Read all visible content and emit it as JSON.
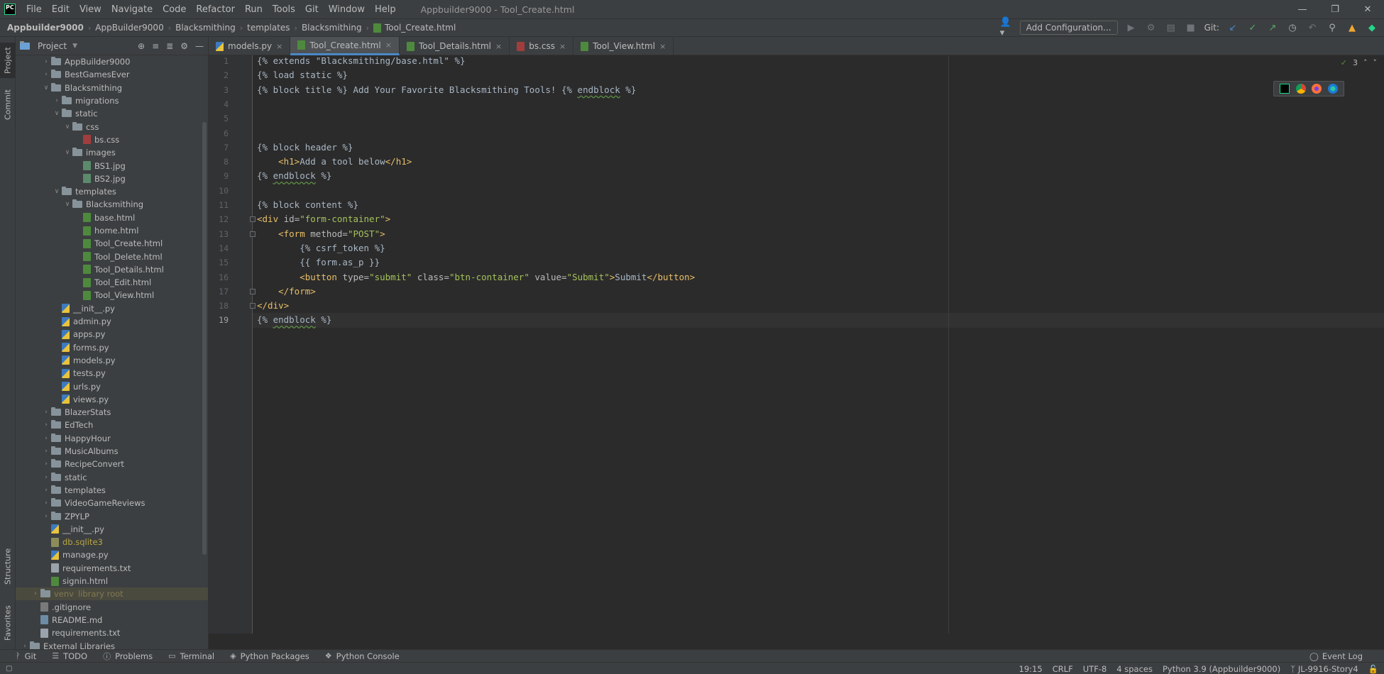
{
  "app": {
    "logo_text": "PC",
    "window_title": "Appbuilder9000 - Tool_Create.html",
    "menu": [
      "File",
      "Edit",
      "View",
      "Navigate",
      "Code",
      "Refactor",
      "Run",
      "Tools",
      "Git",
      "Window",
      "Help"
    ]
  },
  "breadcrumbs": [
    "Appbuilder9000",
    "AppBuilder9000",
    "Blacksmithing",
    "templates",
    "Blacksmithing",
    "Tool_Create.html"
  ],
  "toolbar": {
    "add_configuration": "Add Configuration...",
    "git_label": "Git:"
  },
  "left_stripe": {
    "project": "Project",
    "commit": "Commit",
    "structure": "Structure",
    "favorites": "Favorites"
  },
  "project_panel": {
    "title": "Project",
    "tree": [
      {
        "label": "AppBuilder9000",
        "type": "folder",
        "depth": 3,
        "expanded": false
      },
      {
        "label": "BestGamesEver",
        "type": "folder",
        "depth": 3,
        "expanded": false
      },
      {
        "label": "Blacksmithing",
        "type": "folder",
        "depth": 3,
        "expanded": true
      },
      {
        "label": "migrations",
        "type": "folder",
        "depth": 4,
        "expanded": false
      },
      {
        "label": "static",
        "type": "folder",
        "depth": 4,
        "expanded": true
      },
      {
        "label": "css",
        "type": "folder",
        "depth": 5,
        "expanded": true
      },
      {
        "label": "bs.css",
        "type": "css",
        "depth": 6
      },
      {
        "label": "images",
        "type": "folder",
        "depth": 5,
        "expanded": true
      },
      {
        "label": "BS1.jpg",
        "type": "img",
        "depth": 6
      },
      {
        "label": "BS2.jpg",
        "type": "img",
        "depth": 6
      },
      {
        "label": "templates",
        "type": "folder",
        "depth": 4,
        "expanded": true
      },
      {
        "label": "Blacksmithing",
        "type": "folder",
        "depth": 5,
        "expanded": true
      },
      {
        "label": "base.html",
        "type": "html",
        "depth": 6
      },
      {
        "label": "home.html",
        "type": "html",
        "depth": 6
      },
      {
        "label": "Tool_Create.html",
        "type": "html",
        "depth": 6
      },
      {
        "label": "Tool_Delete.html",
        "type": "html",
        "depth": 6
      },
      {
        "label": "Tool_Details.html",
        "type": "html",
        "depth": 6
      },
      {
        "label": "Tool_Edit.html",
        "type": "html",
        "depth": 6
      },
      {
        "label": "Tool_View.html",
        "type": "html",
        "depth": 6
      },
      {
        "label": "__init__.py",
        "type": "py",
        "depth": 4
      },
      {
        "label": "admin.py",
        "type": "py",
        "depth": 4
      },
      {
        "label": "apps.py",
        "type": "py",
        "depth": 4
      },
      {
        "label": "forms.py",
        "type": "py",
        "depth": 4
      },
      {
        "label": "models.py",
        "type": "py",
        "depth": 4
      },
      {
        "label": "tests.py",
        "type": "py",
        "depth": 4
      },
      {
        "label": "urls.py",
        "type": "py",
        "depth": 4
      },
      {
        "label": "views.py",
        "type": "py",
        "depth": 4
      },
      {
        "label": "BlazerStats",
        "type": "folder",
        "depth": 3,
        "expanded": false
      },
      {
        "label": "EdTech",
        "type": "folder",
        "depth": 3,
        "expanded": false
      },
      {
        "label": "HappyHour",
        "type": "folder",
        "depth": 3,
        "expanded": false
      },
      {
        "label": "MusicAlbums",
        "type": "folder",
        "depth": 3,
        "expanded": false
      },
      {
        "label": "RecipeConvert",
        "type": "folder",
        "depth": 3,
        "expanded": false
      },
      {
        "label": "static",
        "type": "folder",
        "depth": 3,
        "expanded": false
      },
      {
        "label": "templates",
        "type": "folder",
        "depth": 3,
        "expanded": false
      },
      {
        "label": "VideoGameReviews",
        "type": "folder",
        "depth": 3,
        "expanded": false
      },
      {
        "label": "ZPYLP",
        "type": "folder",
        "depth": 3,
        "expanded": false
      },
      {
        "label": "__init__.py",
        "type": "py",
        "depth": 3
      },
      {
        "label": "db.sqlite3",
        "type": "db",
        "depth": 3,
        "muted": true
      },
      {
        "label": "manage.py",
        "type": "py",
        "depth": 3
      },
      {
        "label": "requirements.txt",
        "type": "txt",
        "depth": 3
      },
      {
        "label": "signin.html",
        "type": "html",
        "depth": 3
      },
      {
        "label": "venv",
        "suffix": "library root",
        "type": "folder",
        "depth": 2,
        "expanded": false,
        "selected": true
      },
      {
        "label": ".gitignore",
        "type": "git",
        "depth": 2
      },
      {
        "label": "README.md",
        "type": "md",
        "depth": 2
      },
      {
        "label": "requirements.txt",
        "type": "txt",
        "depth": 2
      },
      {
        "label": "External Libraries",
        "type": "folder",
        "depth": 1,
        "expanded": false
      }
    ]
  },
  "tabs": [
    {
      "label": "models.py",
      "type": "py",
      "active": false
    },
    {
      "label": "Tool_Create.html",
      "type": "html",
      "active": true
    },
    {
      "label": "Tool_Details.html",
      "type": "html",
      "active": false
    },
    {
      "label": "bs.css",
      "type": "css",
      "active": false
    },
    {
      "label": "Tool_View.html",
      "type": "html",
      "active": false
    }
  ],
  "editor": {
    "inspection_count": "3",
    "current_line": 19,
    "lines": [
      [
        {
          "t": "{% extends ",
          "c": "tpl"
        },
        {
          "t": "\"Blacksmithing/base.html\"",
          "c": "tpl"
        },
        {
          "t": " %}",
          "c": "tpl"
        }
      ],
      [
        {
          "t": "{% load static %}",
          "c": "tpl"
        }
      ],
      [
        {
          "t": "{% block title %} Add Your Favorite Blacksmithing Tools! {% ",
          "c": "tpl"
        },
        {
          "t": "endblock",
          "c": "under"
        },
        {
          "t": " %}",
          "c": "tpl"
        }
      ],
      [],
      [],
      [],
      [
        {
          "t": "{% block header %}",
          "c": "tpl"
        }
      ],
      [
        {
          "t": "    ",
          "c": "tpl"
        },
        {
          "t": "<h1>",
          "c": "tag"
        },
        {
          "t": "Add a tool below",
          "c": "tpl"
        },
        {
          "t": "</h1>",
          "c": "tag"
        }
      ],
      [
        {
          "t": "{% ",
          "c": "tpl"
        },
        {
          "t": "endblock",
          "c": "under"
        },
        {
          "t": " %}",
          "c": "tpl"
        }
      ],
      [],
      [
        {
          "t": "{% block content %}",
          "c": "tpl"
        }
      ],
      [
        {
          "t": "<div ",
          "c": "tag"
        },
        {
          "t": "id=",
          "c": "attr"
        },
        {
          "t": "\"form-container\"",
          "c": "str"
        },
        {
          "t": ">",
          "c": "tag"
        }
      ],
      [
        {
          "t": "    ",
          "c": "tpl"
        },
        {
          "t": "<form ",
          "c": "tag"
        },
        {
          "t": "method=",
          "c": "attr"
        },
        {
          "t": "\"POST\"",
          "c": "str"
        },
        {
          "t": ">",
          "c": "tag"
        }
      ],
      [
        {
          "t": "        {% csrf_token %}",
          "c": "tpl"
        }
      ],
      [
        {
          "t": "        {{ form.as_p }}",
          "c": "tpl"
        }
      ],
      [
        {
          "t": "        ",
          "c": "tpl"
        },
        {
          "t": "<button ",
          "c": "tag"
        },
        {
          "t": "type=",
          "c": "attr"
        },
        {
          "t": "\"submit\" ",
          "c": "str"
        },
        {
          "t": "class=",
          "c": "attr"
        },
        {
          "t": "\"btn-container\" ",
          "c": "str"
        },
        {
          "t": "value=",
          "c": "attr"
        },
        {
          "t": "\"Submit\"",
          "c": "str"
        },
        {
          "t": ">",
          "c": "tag"
        },
        {
          "t": "Submit",
          "c": "tpl"
        },
        {
          "t": "</button>",
          "c": "tag"
        }
      ],
      [
        {
          "t": "    ",
          "c": "tpl"
        },
        {
          "t": "</form>",
          "c": "tag"
        }
      ],
      [
        {
          "t": "</div>",
          "c": "tag"
        }
      ],
      [
        {
          "t": "{% ",
          "c": "tpl"
        },
        {
          "t": "endblock",
          "c": "under"
        },
        {
          "t": " %}",
          "c": "tpl"
        }
      ]
    ],
    "fold_lines": [
      12,
      13,
      17,
      18
    ]
  },
  "bottom_tools": [
    {
      "label": "Git",
      "icon": "git-branch-icon"
    },
    {
      "label": "TODO",
      "icon": "todo-list-icon"
    },
    {
      "label": "Problems",
      "icon": "problems-icon"
    },
    {
      "label": "Terminal",
      "icon": "terminal-icon"
    },
    {
      "label": "Python Packages",
      "icon": "packages-icon"
    },
    {
      "label": "Python Console",
      "icon": "python-console-icon"
    }
  ],
  "event_log": "Event Log",
  "status": {
    "position": "19:15",
    "line_separator": "CRLF",
    "encoding": "UTF-8",
    "indent": "4 spaces",
    "interpreter": "Python 3.9 (Appbuilder9000)",
    "branch": "JL-9916-Story4"
  },
  "colors": {
    "background": "#2b2b2b",
    "panel": "#3c3f41",
    "accent": "#4a88c7",
    "tag": "#e8bf6a",
    "string": "#a5c25c"
  }
}
